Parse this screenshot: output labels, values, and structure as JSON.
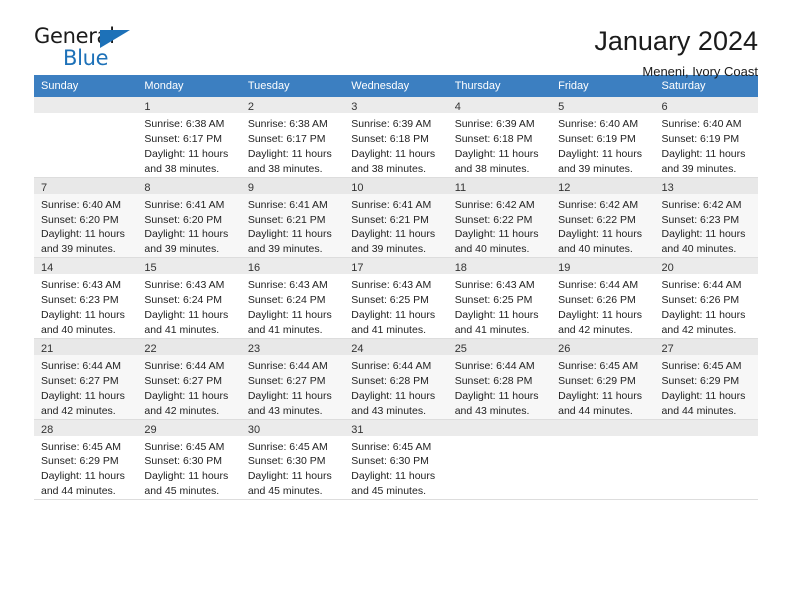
{
  "brand": {
    "name_top": "General",
    "name_bottom": "Blue",
    "triangle_color": "#1d71b8"
  },
  "header": {
    "title": "January 2024",
    "subtitle": "Meneni, Ivory Coast"
  },
  "theme": {
    "header_row_bg": "#3c7fc1",
    "header_row_text": "#ffffff",
    "daynum_bg": "#ebebeb",
    "row_alt_bg": "#f7f7f7",
    "grid_line": "#dddddd"
  },
  "columns": [
    "Sunday",
    "Monday",
    "Tuesday",
    "Wednesday",
    "Thursday",
    "Friday",
    "Saturday"
  ],
  "labels": {
    "sunrise": "Sunrise:",
    "sunset": "Sunset:",
    "daylight": "Daylight:"
  },
  "weeks": [
    [
      {
        "day": "",
        "lines": []
      },
      {
        "day": "1",
        "lines": [
          "Sunrise: 6:38 AM",
          "Sunset: 6:17 PM",
          "Daylight: 11 hours",
          "and 38 minutes."
        ]
      },
      {
        "day": "2",
        "lines": [
          "Sunrise: 6:38 AM",
          "Sunset: 6:17 PM",
          "Daylight: 11 hours",
          "and 38 minutes."
        ]
      },
      {
        "day": "3",
        "lines": [
          "Sunrise: 6:39 AM",
          "Sunset: 6:18 PM",
          "Daylight: 11 hours",
          "and 38 minutes."
        ]
      },
      {
        "day": "4",
        "lines": [
          "Sunrise: 6:39 AM",
          "Sunset: 6:18 PM",
          "Daylight: 11 hours",
          "and 38 minutes."
        ]
      },
      {
        "day": "5",
        "lines": [
          "Sunrise: 6:40 AM",
          "Sunset: 6:19 PM",
          "Daylight: 11 hours",
          "and 39 minutes."
        ]
      },
      {
        "day": "6",
        "lines": [
          "Sunrise: 6:40 AM",
          "Sunset: 6:19 PM",
          "Daylight: 11 hours",
          "and 39 minutes."
        ]
      }
    ],
    [
      {
        "day": "7",
        "lines": [
          "Sunrise: 6:40 AM",
          "Sunset: 6:20 PM",
          "Daylight: 11 hours",
          "and 39 minutes."
        ]
      },
      {
        "day": "8",
        "lines": [
          "Sunrise: 6:41 AM",
          "Sunset: 6:20 PM",
          "Daylight: 11 hours",
          "and 39 minutes."
        ]
      },
      {
        "day": "9",
        "lines": [
          "Sunrise: 6:41 AM",
          "Sunset: 6:21 PM",
          "Daylight: 11 hours",
          "and 39 minutes."
        ]
      },
      {
        "day": "10",
        "lines": [
          "Sunrise: 6:41 AM",
          "Sunset: 6:21 PM",
          "Daylight: 11 hours",
          "and 39 minutes."
        ]
      },
      {
        "day": "11",
        "lines": [
          "Sunrise: 6:42 AM",
          "Sunset: 6:22 PM",
          "Daylight: 11 hours",
          "and 40 minutes."
        ]
      },
      {
        "day": "12",
        "lines": [
          "Sunrise: 6:42 AM",
          "Sunset: 6:22 PM",
          "Daylight: 11 hours",
          "and 40 minutes."
        ]
      },
      {
        "day": "13",
        "lines": [
          "Sunrise: 6:42 AM",
          "Sunset: 6:23 PM",
          "Daylight: 11 hours",
          "and 40 minutes."
        ]
      }
    ],
    [
      {
        "day": "14",
        "lines": [
          "Sunrise: 6:43 AM",
          "Sunset: 6:23 PM",
          "Daylight: 11 hours",
          "and 40 minutes."
        ]
      },
      {
        "day": "15",
        "lines": [
          "Sunrise: 6:43 AM",
          "Sunset: 6:24 PM",
          "Daylight: 11 hours",
          "and 41 minutes."
        ]
      },
      {
        "day": "16",
        "lines": [
          "Sunrise: 6:43 AM",
          "Sunset: 6:24 PM",
          "Daylight: 11 hours",
          "and 41 minutes."
        ]
      },
      {
        "day": "17",
        "lines": [
          "Sunrise: 6:43 AM",
          "Sunset: 6:25 PM",
          "Daylight: 11 hours",
          "and 41 minutes."
        ]
      },
      {
        "day": "18",
        "lines": [
          "Sunrise: 6:43 AM",
          "Sunset: 6:25 PM",
          "Daylight: 11 hours",
          "and 41 minutes."
        ]
      },
      {
        "day": "19",
        "lines": [
          "Sunrise: 6:44 AM",
          "Sunset: 6:26 PM",
          "Daylight: 11 hours",
          "and 42 minutes."
        ]
      },
      {
        "day": "20",
        "lines": [
          "Sunrise: 6:44 AM",
          "Sunset: 6:26 PM",
          "Daylight: 11 hours",
          "and 42 minutes."
        ]
      }
    ],
    [
      {
        "day": "21",
        "lines": [
          "Sunrise: 6:44 AM",
          "Sunset: 6:27 PM",
          "Daylight: 11 hours",
          "and 42 minutes."
        ]
      },
      {
        "day": "22",
        "lines": [
          "Sunrise: 6:44 AM",
          "Sunset: 6:27 PM",
          "Daylight: 11 hours",
          "and 42 minutes."
        ]
      },
      {
        "day": "23",
        "lines": [
          "Sunrise: 6:44 AM",
          "Sunset: 6:27 PM",
          "Daylight: 11 hours",
          "and 43 minutes."
        ]
      },
      {
        "day": "24",
        "lines": [
          "Sunrise: 6:44 AM",
          "Sunset: 6:28 PM",
          "Daylight: 11 hours",
          "and 43 minutes."
        ]
      },
      {
        "day": "25",
        "lines": [
          "Sunrise: 6:44 AM",
          "Sunset: 6:28 PM",
          "Daylight: 11 hours",
          "and 43 minutes."
        ]
      },
      {
        "day": "26",
        "lines": [
          "Sunrise: 6:45 AM",
          "Sunset: 6:29 PM",
          "Daylight: 11 hours",
          "and 44 minutes."
        ]
      },
      {
        "day": "27",
        "lines": [
          "Sunrise: 6:45 AM",
          "Sunset: 6:29 PM",
          "Daylight: 11 hours",
          "and 44 minutes."
        ]
      }
    ],
    [
      {
        "day": "28",
        "lines": [
          "Sunrise: 6:45 AM",
          "Sunset: 6:29 PM",
          "Daylight: 11 hours",
          "and 44 minutes."
        ]
      },
      {
        "day": "29",
        "lines": [
          "Sunrise: 6:45 AM",
          "Sunset: 6:30 PM",
          "Daylight: 11 hours",
          "and 45 minutes."
        ]
      },
      {
        "day": "30",
        "lines": [
          "Sunrise: 6:45 AM",
          "Sunset: 6:30 PM",
          "Daylight: 11 hours",
          "and 45 minutes."
        ]
      },
      {
        "day": "31",
        "lines": [
          "Sunrise: 6:45 AM",
          "Sunset: 6:30 PM",
          "Daylight: 11 hours",
          "and 45 minutes."
        ]
      },
      {
        "day": "",
        "lines": []
      },
      {
        "day": "",
        "lines": []
      },
      {
        "day": "",
        "lines": []
      }
    ]
  ]
}
